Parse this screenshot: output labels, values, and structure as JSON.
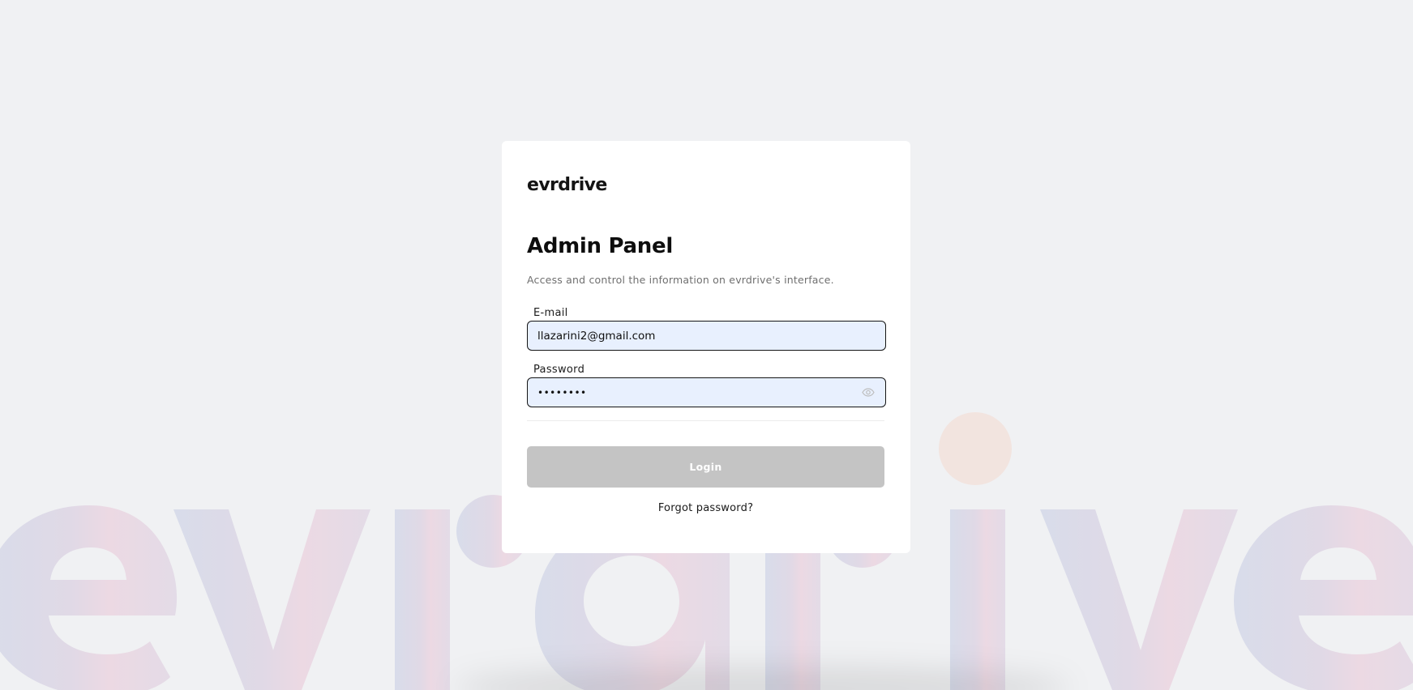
{
  "brand": {
    "logo_text": "evrdrive",
    "background_wordmark": "evrdrive"
  },
  "login": {
    "title": "Admin Panel",
    "subtitle": "Access and control the information on evrdrive's interface.",
    "email": {
      "label": "E-mail",
      "value": "llazarini2@gmail.com"
    },
    "password": {
      "label": "Password",
      "masked_value": "••••••••",
      "toggle_icon": "eye-icon"
    },
    "submit_label": "Login",
    "forgot_label": "Forgot password?"
  },
  "colors": {
    "page_background": "#f0f1f3",
    "card_background": "#ffffff",
    "input_background": "#e8f0fe",
    "button_disabled": "#c4c4c4",
    "wordmark_blue": "#d8dcea",
    "wordmark_pink": "#eed8e3",
    "wordmark_peach": "#f2e4df"
  }
}
